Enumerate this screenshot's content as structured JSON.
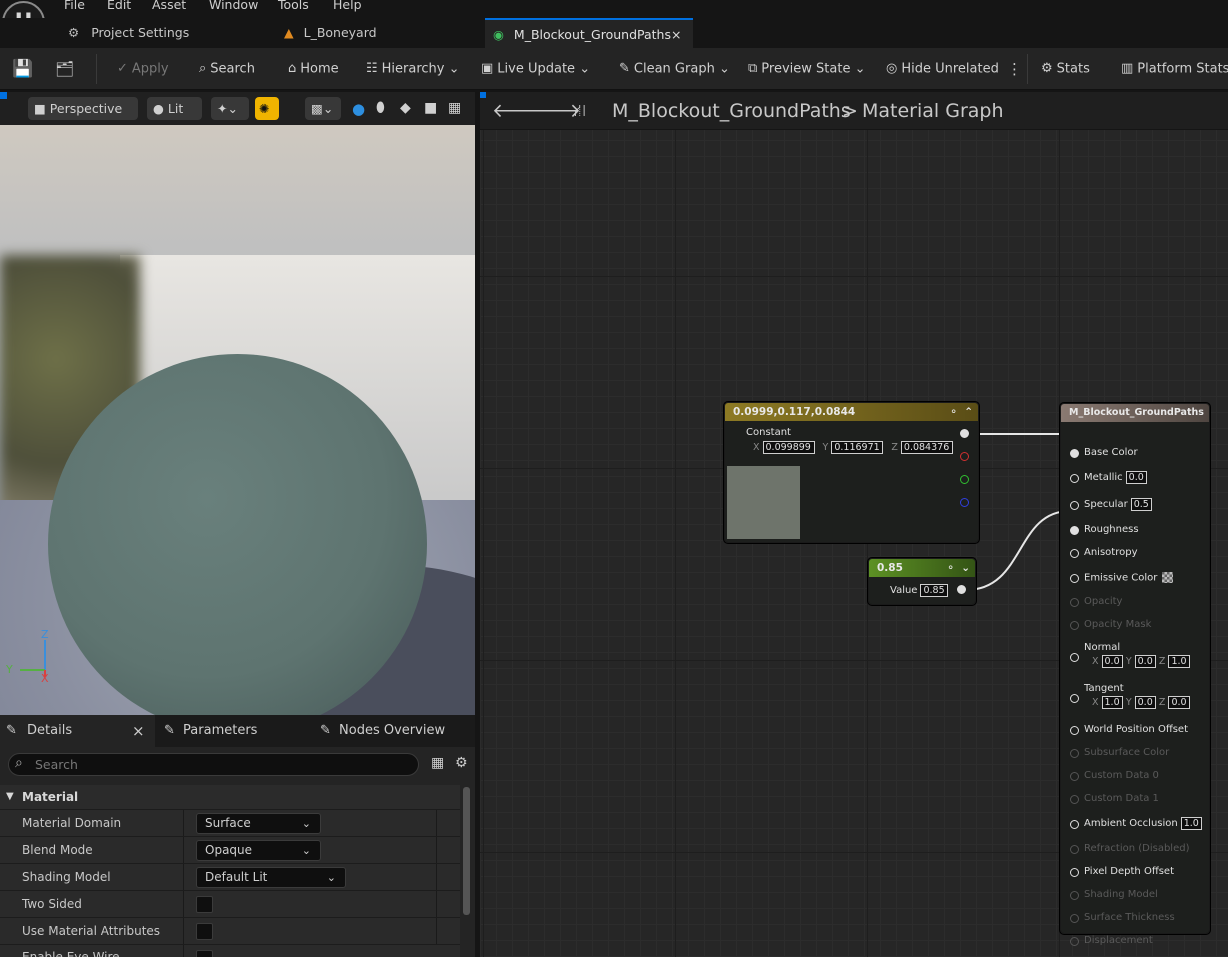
{
  "menu": [
    "File",
    "Edit",
    "Asset",
    "Window",
    "Tools",
    "Help"
  ],
  "tabs": [
    {
      "label": "Project Settings",
      "icon": "settings-gear-icon"
    },
    {
      "label": "L_Boneyard",
      "icon": "level-icon"
    },
    {
      "label": "M_Blockout_GroundPaths",
      "icon": "material-icon",
      "close": "×"
    }
  ],
  "toolbar": {
    "apply": "Apply",
    "search": "Search",
    "home": "Home",
    "hierarchy": "Hierarchy",
    "live_update": "Live Update",
    "clean_graph": "Clean Graph",
    "preview_state": "Preview State",
    "hide_unrelated": "Hide Unrelated",
    "stats": "Stats",
    "platform_stats": "Platform Stats"
  },
  "viewport": {
    "perspective": "Perspective",
    "lit": "Lit",
    "axes": {
      "z": "Z",
      "y": "Y",
      "x": "X"
    }
  },
  "details": {
    "tabs": [
      "Details",
      "Parameters",
      "Nodes Overview"
    ],
    "close": "×",
    "search_placeholder": "Search",
    "category": "Material",
    "rows": [
      {
        "label": "Material Domain",
        "value": "Surface",
        "type": "dropdown"
      },
      {
        "label": "Blend Mode",
        "value": "Opaque",
        "type": "dropdown"
      },
      {
        "label": "Shading Model",
        "value": "Default Lit",
        "type": "dropdown"
      },
      {
        "label": "Two Sided",
        "type": "checkbox",
        "checked": false
      },
      {
        "label": "Use Material Attributes",
        "type": "checkbox",
        "checked": false
      },
      {
        "label": "Enable Eye Wire",
        "type": "checkbox",
        "checked": false
      }
    ]
  },
  "graph": {
    "breadcrumb_asset": "M_Blockout_GroundPaths",
    "breadcrumb_sep": ">",
    "breadcrumb_graph": "Material Graph",
    "constant_node": {
      "title": "0.0999,0.117,0.0844",
      "label": "Constant",
      "x_label": "X",
      "x": "0.099899",
      "y_label": "Y",
      "y": "0.116971",
      "z_label": "Z",
      "z": "0.084376",
      "swatch_color": "#6e746b",
      "header_color": "#7a6a1e"
    },
    "scalar_node": {
      "title": "0.85",
      "value_label": "Value",
      "value": "0.85",
      "header_color": "#4f7d1f"
    },
    "result_node": {
      "title": "M_Blockout_GroundPaths",
      "pins": [
        {
          "label": "Base Color",
          "enabled": true
        },
        {
          "label": "Metallic",
          "enabled": true,
          "value": "0.0"
        },
        {
          "label": "Specular",
          "enabled": true,
          "value": "0.5"
        },
        {
          "label": "Roughness",
          "enabled": true
        },
        {
          "label": "Anisotropy",
          "enabled": true
        },
        {
          "label": "Emissive Color",
          "enabled": true
        },
        {
          "label": "Opacity",
          "enabled": false
        },
        {
          "label": "Opacity Mask",
          "enabled": false
        },
        {
          "label": "Normal",
          "enabled": true,
          "x": "0.0",
          "y": "0.0",
          "z": "1.0"
        },
        {
          "label": "Tangent",
          "enabled": true,
          "x": "1.0",
          "y": "0.0",
          "z": "0.0"
        },
        {
          "label": "World Position Offset",
          "enabled": true
        },
        {
          "label": "Subsurface Color",
          "enabled": false
        },
        {
          "label": "Custom Data 0",
          "enabled": false
        },
        {
          "label": "Custom Data 1",
          "enabled": false
        },
        {
          "label": "Ambient Occlusion",
          "enabled": true,
          "value": "1.0"
        },
        {
          "label": "Refraction (Disabled)",
          "enabled": false
        },
        {
          "label": "Pixel Depth Offset",
          "enabled": true
        },
        {
          "label": "Shading Model",
          "enabled": false
        },
        {
          "label": "Surface Thickness",
          "enabled": false
        },
        {
          "label": "Displacement",
          "enabled": false
        }
      ]
    }
  }
}
